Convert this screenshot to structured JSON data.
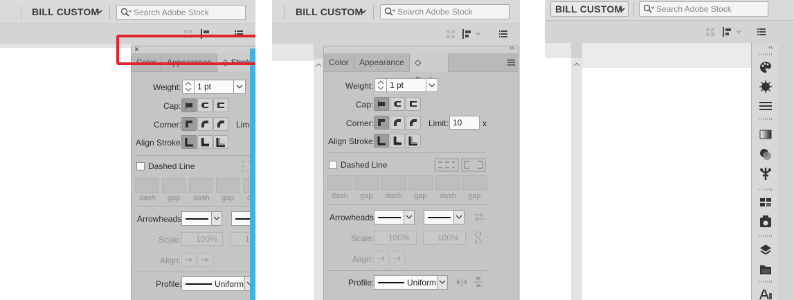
{
  "app_bar": {
    "workspace_label": "BILL CUSTOM",
    "search_placeholder": "Search Adobe Stock"
  },
  "stroke_panel": {
    "tabs": [
      {
        "label": "Color"
      },
      {
        "label": "Appearance"
      },
      {
        "label": "◇ Stroke"
      }
    ],
    "tabs_f2": [
      {
        "label": "Color"
      },
      {
        "label": "Appearance"
      },
      {
        "label": "◇ Stroke"
      }
    ],
    "weight_label": "Weight:",
    "weight_value": "1 pt",
    "cap_label": "Cap:",
    "corner_label": "Corner:",
    "limit_label": "Limit:",
    "limit_value": "10",
    "limit_unit": "x",
    "align_stroke_label": "Align Stroke:",
    "dashed_line_label": "Dashed Line",
    "dash_labels": [
      "dash",
      "gap",
      "dash",
      "gap",
      "dash",
      "gap"
    ],
    "arrowheads_label": "Arrowheads:",
    "scale_label": "Scale:",
    "scale_start": "100%",
    "scale_end": "100%",
    "align_label": "Align:",
    "profile_label": "Profile:",
    "profile_value": "Uniform",
    "close_glyph": "×",
    "collapse_glyph": "››",
    "dock_collapse_glyph": "‹‹"
  },
  "colors": {
    "highlight_red": "#e0242f",
    "highlight_blue": "#45b0e0",
    "panel_bg": "#c5c5c5",
    "chrome_bg": "#dadada"
  },
  "dock_icons": [
    "color-palette-icon",
    "sunburst-brush-icon",
    "stroke-lines-icon",
    "gradient-icon",
    "transparency-icon",
    "puppet-warp-icon",
    "artboards-icon",
    "asset-export-icon",
    "layers-icon",
    "libraries-folder-icon",
    "character-icon"
  ]
}
